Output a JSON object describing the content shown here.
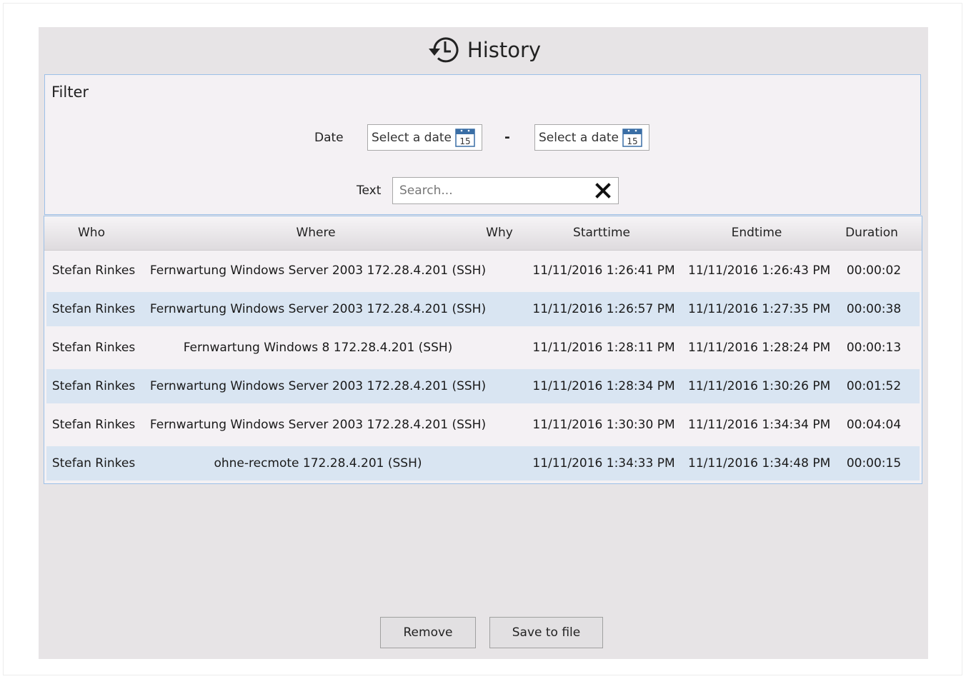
{
  "window": {
    "title": "History"
  },
  "filter": {
    "title": "Filter",
    "date_label": "Date",
    "date_from_placeholder": "Select a date",
    "date_to_placeholder": "Select a date",
    "calendar_day": "15",
    "date_separator": "-",
    "text_label": "Text",
    "search_placeholder": "Search..."
  },
  "table": {
    "columns": [
      "Who",
      "Where",
      "Why",
      "Starttime",
      "Endtime",
      "Duration"
    ],
    "rows": [
      {
        "who": "Stefan Rinkes",
        "where": "Fernwartung Windows Server 2003 172.28.4.201 (SSH)",
        "why": "",
        "start": "11/11/2016 1:26:41 PM",
        "end": "11/11/2016 1:26:43 PM",
        "duration": "00:00:02"
      },
      {
        "who": "Stefan Rinkes",
        "where": "Fernwartung Windows Server 2003 172.28.4.201 (SSH)",
        "why": "",
        "start": "11/11/2016 1:26:57 PM",
        "end": "11/11/2016 1:27:35 PM",
        "duration": "00:00:38"
      },
      {
        "who": "Stefan Rinkes",
        "where": "Fernwartung Windows 8 172.28.4.201 (SSH)",
        "why": "",
        "start": "11/11/2016 1:28:11 PM",
        "end": "11/11/2016 1:28:24 PM",
        "duration": "00:00:13"
      },
      {
        "who": "Stefan Rinkes",
        "where": "Fernwartung Windows Server 2003 172.28.4.201 (SSH)",
        "why": "",
        "start": "11/11/2016 1:28:34 PM",
        "end": "11/11/2016 1:30:26 PM",
        "duration": "00:01:52"
      },
      {
        "who": "Stefan Rinkes",
        "where": "Fernwartung Windows Server 2003 172.28.4.201 (SSH)",
        "why": "",
        "start": "11/11/2016 1:30:30 PM",
        "end": "11/11/2016 1:34:34 PM",
        "duration": "00:04:04"
      },
      {
        "who": "Stefan Rinkes",
        "where": "ohne-recmote 172.28.4.201 (SSH)",
        "why": "",
        "start": "11/11/2016 1:34:33 PM",
        "end": "11/11/2016 1:34:48 PM",
        "duration": "00:00:15"
      }
    ]
  },
  "buttons": {
    "remove": "Remove",
    "save": "Save to file"
  },
  "icons": {
    "title": "history-icon",
    "date_picker": "calendar-icon",
    "search_clear": "close-icon"
  },
  "colors": {
    "window_bg": "#e7e4e6",
    "panel_border": "#9cc0e8",
    "alt_row": "#d9e5f2",
    "panel_bg": "#f4f1f4"
  }
}
